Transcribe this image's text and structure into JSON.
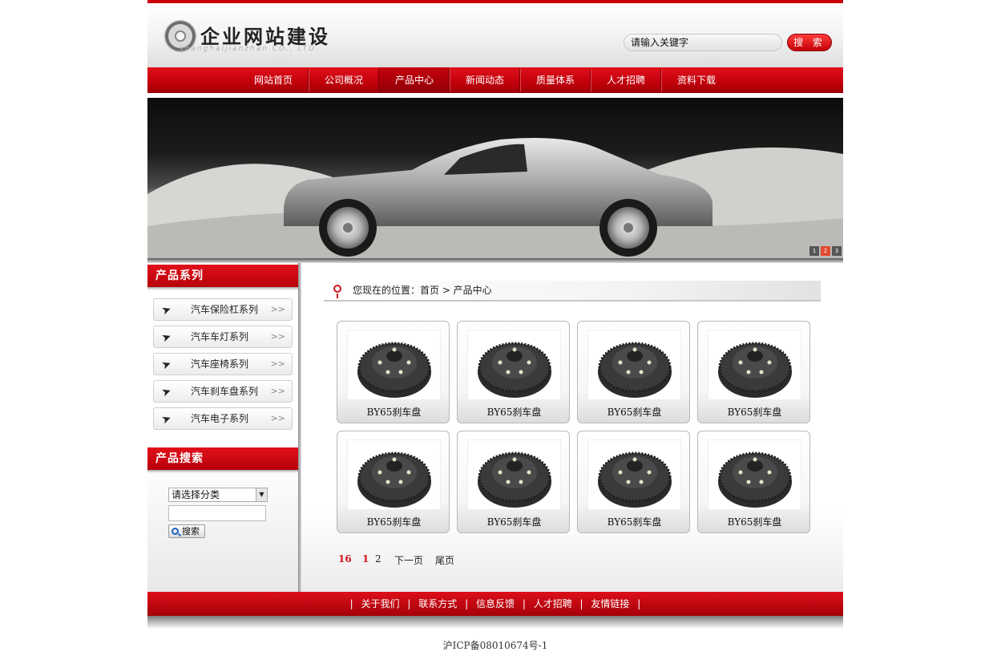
{
  "header": {
    "logo_title": "企业网站建设",
    "logo_subtitle": "shanghaijianzhan CO., LTD.",
    "search_placeholder": "请输入关键字",
    "search_button": "搜 索"
  },
  "nav": {
    "items": [
      {
        "label": "网站首页"
      },
      {
        "label": "公司概况"
      },
      {
        "label": "产品中心",
        "active": true
      },
      {
        "label": "新闻动态"
      },
      {
        "label": "质量体系"
      },
      {
        "label": "人才招聘"
      },
      {
        "label": "资料下载"
      }
    ]
  },
  "banner": {
    "dots": [
      "1",
      "2",
      "3"
    ],
    "active_dot": "2"
  },
  "sidebar": {
    "category_title": "产品系列",
    "categories": [
      {
        "label": "汽车保险杠系列"
      },
      {
        "label": "汽车车灯系列"
      },
      {
        "label": "汽车座椅系列"
      },
      {
        "label": "汽车刹车盘系列"
      },
      {
        "label": "汽车电子系列"
      }
    ],
    "search_title": "产品搜索",
    "select_value": "请选择分类",
    "search_button": "搜索"
  },
  "breadcrumb": {
    "text": "您现在的位置：首页 > 产品中心"
  },
  "products": [
    {
      "name": "BY65刹车盘"
    },
    {
      "name": "BY65刹车盘"
    },
    {
      "name": "BY65刹车盘"
    },
    {
      "name": "BY65刹车盘"
    },
    {
      "name": "BY65刹车盘"
    },
    {
      "name": "BY65刹车盘"
    },
    {
      "name": "BY65刹车盘"
    },
    {
      "name": "BY65刹车盘"
    }
  ],
  "pager": {
    "total": "16",
    "pages": [
      "1",
      "2"
    ],
    "current": "1",
    "next": "下一页",
    "last": "尾页"
  },
  "footer": {
    "links": [
      {
        "label": "关于我们"
      },
      {
        "label": "联系方式"
      },
      {
        "label": "信息反馈"
      },
      {
        "label": "人才招聘"
      },
      {
        "label": "友情链接"
      }
    ],
    "separator": "|",
    "icp": "沪ICP备08010674号-1"
  },
  "colors": {
    "brand_red": "#c9000b",
    "pager_red": "#d0141c"
  }
}
